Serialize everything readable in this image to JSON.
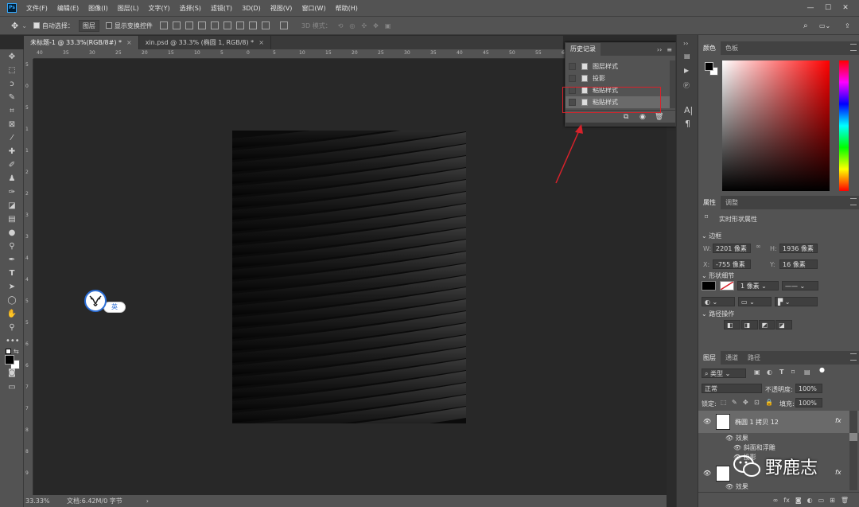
{
  "app": {
    "logo": "Ps"
  },
  "menu": [
    "文件(F)",
    "编辑(E)",
    "图像(I)",
    "图层(L)",
    "文字(Y)",
    "选择(S)",
    "滤镜(T)",
    "3D(D)",
    "视图(V)",
    "窗口(W)",
    "帮助(H)"
  ],
  "options": {
    "auto_select_label": "自动选择：",
    "auto_select_value": "图层",
    "show_transform_label": "显示变换控件",
    "mode_3d_label": "3D 模式："
  },
  "tabs": [
    {
      "label": "未标题-1 @ 33.3%(RGB/8#) *",
      "close": "×"
    },
    {
      "label": "xin.psd @ 33.3% (椭圆 1, RGB/8) *",
      "close": "×"
    }
  ],
  "ruler_h": [
    "40",
    "35",
    "30",
    "25",
    "20",
    "15",
    "10",
    "5",
    "0",
    "5",
    "10",
    "15",
    "20",
    "25",
    "30",
    "35",
    "40",
    "45",
    "50",
    "55",
    "60",
    "65"
  ],
  "ruler_v": [
    "5",
    "0",
    "5",
    "1",
    "1",
    "2",
    "2",
    "3",
    "3",
    "4",
    "4",
    "5",
    "5",
    "6",
    "6",
    "7",
    "7",
    "8",
    "8",
    "9"
  ],
  "status": {
    "zoom": "33.33%",
    "doc_info": "文档:6.42M/0 字节"
  },
  "history": {
    "title": "历史记录",
    "items": [
      "图层样式",
      "投影",
      "粘贴样式",
      "粘贴样式"
    ]
  },
  "ime": {
    "label": "英"
  },
  "color_panel": {
    "tabs": [
      "颜色",
      "色板"
    ],
    "accent": "#d8222b"
  },
  "properties": {
    "tabs": [
      "属性",
      "调整"
    ],
    "title": "实时形状属性",
    "border_label": "边框",
    "w_label": "W:",
    "w": "2201 像素",
    "h_label": "H:",
    "h": "1936 像素",
    "x_label": "X:",
    "x": "-755 像素",
    "y_label": "Y:",
    "y": "16 像素",
    "shape_label": "形状细节",
    "stroke": "1 像素",
    "path_label": "路径操作"
  },
  "layers": {
    "tabs": [
      "图层",
      "通道",
      "路径"
    ],
    "filter": "类型",
    "blend": "正常",
    "opacity_label": "不透明度:",
    "opacity": "100%",
    "lock_label": "锁定:",
    "fill_label": "填充:",
    "fill": "100%",
    "layer1": "椭圆 1 拷贝 12",
    "effects": "效果",
    "bevel": "斜面和浮雕",
    "shadow": "投影",
    "effects2": "效果",
    "fx": "fx"
  },
  "watermark": {
    "text": "野鹿志"
  }
}
